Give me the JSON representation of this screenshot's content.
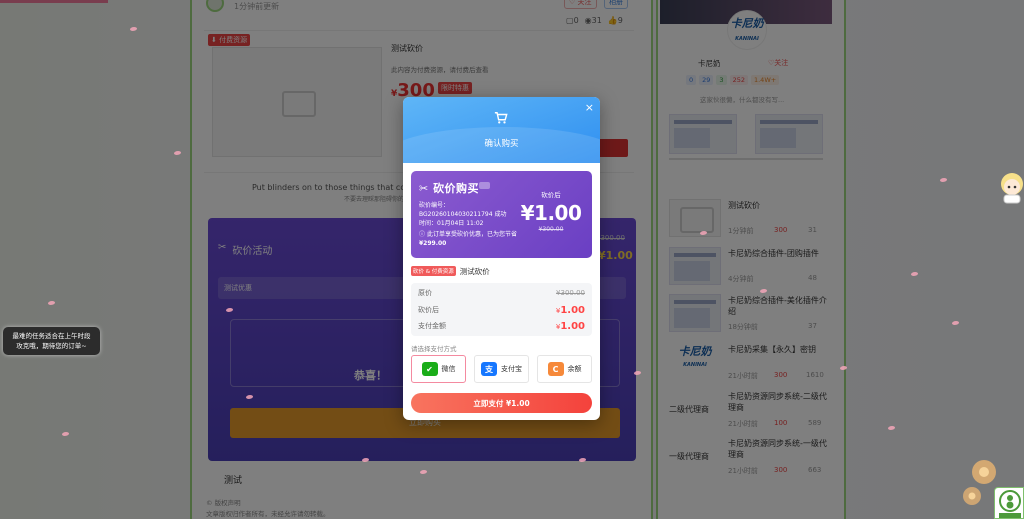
{
  "background": {
    "post": {
      "updated": "1分钟前更新",
      "btn_follow": "关注",
      "btn_share": "相册",
      "stats": {
        "comments": "0",
        "views": "31",
        "likes": "9"
      },
      "paid_tag": "付费资源",
      "title": "测试砍价",
      "desc": "此内容为付费资源，请付费后查看",
      "price_symbol": "¥",
      "price": "300",
      "price_badge": "限时特惠",
      "quote": "Put blinders on to those things that conspire",
      "quote_sub": "不要去理睬那阻碍你的",
      "activity_title": "砍价活动",
      "activity_input": "测试优惠",
      "activity_orig": "¥300.00",
      "activity_price": "¥1.00",
      "activity_congrats": "恭喜！",
      "activity_btn": "立即购买",
      "section_title": "测试",
      "copyright_title": "© 版权声明",
      "copyright_text": "文章版权归作者所有，未经允许请勿转载。"
    },
    "sidebar": {
      "author_name": "卡尼奶",
      "follow": "关注",
      "counts": [
        "0",
        "29",
        "3",
        "252",
        "1.4W+"
      ],
      "bio": "这家伙很懒，什么都没有写...",
      "items": [
        {
          "title": "测试砍价",
          "time": "1分钟前",
          "price": "300",
          "views": "31"
        },
        {
          "title": "卡尼奶综合插件-团购插件",
          "time": "4分钟前",
          "views": "48"
        },
        {
          "title": "卡尼奶综合插件-美化插件介绍",
          "time": "18分钟前",
          "views": "37"
        },
        {
          "title": "卡尼奶采集【永久】密钥",
          "time": "21小时前",
          "price": "300",
          "views": "1610"
        },
        {
          "title": "卡尼奶资源同步系统-二级代理商",
          "time": "21小时前",
          "price": "100",
          "views": "589"
        },
        {
          "title": "卡尼奶资源同步系统-一级代理商",
          "time": "21小时前",
          "price": "300",
          "views": "663"
        }
      ],
      "item_labels": [
        "二级代理商",
        "一级代理商"
      ],
      "logo_text": "卡尼奶",
      "logo_sub": "KANINAI"
    },
    "tooltip": [
      "最难的任务适合在上午时段",
      "攻克哦，期待您的订单~"
    ]
  },
  "modal": {
    "title": "确认购买",
    "close": "×",
    "bargain": {
      "title": "砍价购买",
      "order_no_label": "砍价编号：",
      "order_no": "BG20260104030211794",
      "order_status": "成功",
      "time_label": "时间：",
      "time": "01月04日 11:02",
      "note": "此订单享受砍价优惠，已为您节省",
      "saved": "¥299.00",
      "after_label": "砍价后",
      "after_price": "¥1.00",
      "orig_price": "¥300.00"
    },
    "product": {
      "tag": "砍价 & 付费资源",
      "name": "测试砍价"
    },
    "table": [
      {
        "label": "原价",
        "value": "¥300.00",
        "style": "strike"
      },
      {
        "label": "砍价后",
        "currency": "¥",
        "amount": "1.00",
        "style": "red"
      },
      {
        "label": "支付金额",
        "currency": "¥",
        "amount": "1.00",
        "style": "red"
      }
    ],
    "pay_label": "请选择支付方式",
    "pay_methods": [
      {
        "name": "微信",
        "icon": "wechat-pay-icon",
        "color": "#1aad19",
        "selected": true
      },
      {
        "name": "支付宝",
        "icon": "alipay-icon",
        "color": "#1677ff",
        "selected": false
      },
      {
        "name": "余额",
        "icon": "balance-icon",
        "color": "#f6893a",
        "selected": false
      }
    ],
    "pay_button": "立即支付  ¥1.00"
  },
  "colors": {
    "accent_blue": "#2f8ff0",
    "accent_purple": "#6a3fc3",
    "pay_red": "#f4423c",
    "frame_green": "#9cd77f"
  }
}
